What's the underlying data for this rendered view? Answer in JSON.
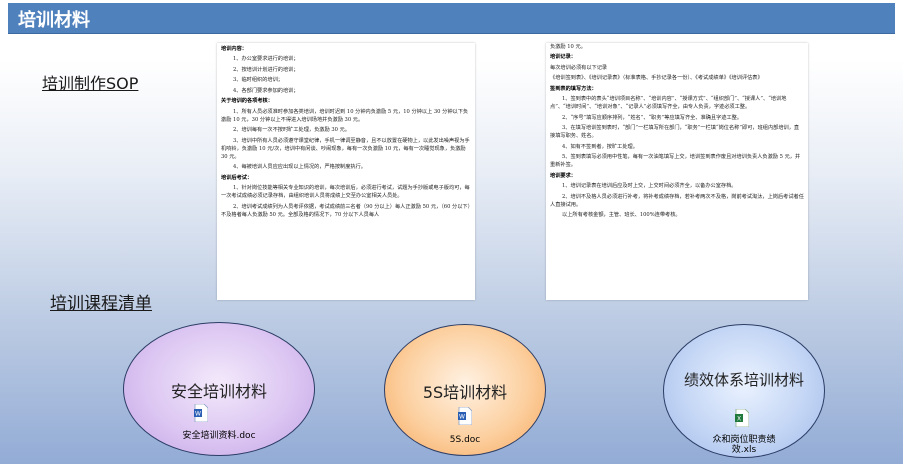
{
  "header": {
    "title": "培训材料"
  },
  "links": {
    "sop": "培训制作SOP",
    "course_list": "培训课程清单"
  },
  "doc_left": {
    "lines": [
      {
        "t": "培训内容：",
        "h": true
      },
      {
        "t": "1、办公室要求进行的培训；",
        "in": true
      },
      {
        "t": "2、按培训计划进行的培训；",
        "in": true
      },
      {
        "t": "3、临时组织的培训；",
        "in": true
      },
      {
        "t": "4、各部门要求参加的培训；",
        "in": true
      },
      {
        "t": "关于培训的各项考核：",
        "h": true
      },
      {
        "t": "1、所有人员必须准时参加各类培训，培训时迟到 10 分钟内负激励 5 元，10 分钟以上 30 分钟以下负激励 10 元，30 分钟以上不得进入培训场地并负激励 30 元。",
        "in": true
      },
      {
        "t": "2、培训每有一次不按时旷工处理，负激励 30 元。",
        "in": true
      },
      {
        "t": "3、培训中所有人员必须遵守课堂纪律，手机一律调至静音，且不以放置在硬物上，以此发出噪声视为手机响铃，负激励 10 元/次，培训中有闲谈、吵闹现象，每有一次负激励 10 元，每有一次睡觉现象，负激励 30 元。",
        "in": true
      },
      {
        "t": "4、每被培训人员应应出现以上情况的，严格按制度执行。",
        "in": true
      },
      {
        "t": "培训后考试：",
        "h": true
      },
      {
        "t": "1、针对岗位技能等相关专业知识的培训，每次培训后，必须进行考试，试题为手抄版或电子版均可，每一次考试成绩必须记录存档，由组织培训人员将成绩上交至办公室相关人员处。",
        "in": true
      },
      {
        "t": "2、培训考试成绩列为人员考评依据，考试成绩前三名者（90 分以上）每人正激励 50 元，（60 分以下）不及格者每人负激励 50 元。全部及格的情况下，70 分以下人员每人",
        "in": true
      }
    ]
  },
  "doc_right": {
    "lines": [
      {
        "t": "负激励 10 元。"
      },
      {
        "t": "培训记录：",
        "h": true
      },
      {
        "t": "每次培训必须有以下记录"
      },
      {
        "t": "《培训签到表》、《培训记录表》（标准表格、手抄记录各一份）、《考试成绩单》《培训评估表》"
      },
      {
        "t": "签到表的填写方法：",
        "h": true
      },
      {
        "t": "1、签到表中的表头“培训项目名称”、“培训内容”、“授课方式”、“组织部门”、“授课人”、“培训地点”、“培训时间”、“培训对象”、“记录人”必须填写齐全，由专人负责，字迹必须工整。",
        "in": true
      },
      {
        "t": "2、“序号”填写应顺序排列，“姓名”、“职务”等应填写齐全、准确且字迹工整。",
        "in": true
      },
      {
        "t": "3、在填写培训签到表时，“部门”一栏填写所在部门，“职务”一栏填“岗位名称”即可，班组内部培训，直接填写职务、姓名。",
        "in": true
      },
      {
        "t": "4、如有不签到者，按旷工处理。",
        "in": true
      },
      {
        "t": "5、签到表填写必须用中性笔，每有一次油笔填写上交，培训签到表作废且对培训负责人负激励 5 元，并重新补签。",
        "in": true
      },
      {
        "t": "培训要求：",
        "h": true
      },
      {
        "t": "1、培训记录表在培训后应及时上交，上交时间必须齐全，以备办公室存档。",
        "in": true
      },
      {
        "t": "2、培训不及格人员必须进行补考，将补考成绩存档，若补考两次不及格，岗前考试淘汰，上岗后考试者任人直接试用。",
        "in": true
      },
      {
        "t": "以上所有考核金额，主管、班长、100%连带考核。",
        "in": true
      }
    ]
  },
  "materials": [
    {
      "label": "安全培训材料",
      "file": "安全培训资料.doc",
      "icon": "word-doc-icon",
      "color": "#c7a8e8"
    },
    {
      "label": "5S培训材料",
      "file": "5S.doc",
      "icon": "word-doc-icon",
      "color": "#f7a85a"
    },
    {
      "label": "绩效体系培训材料",
      "file": "众和岗位职责绩效.xls",
      "icon": "excel-xls-icon",
      "color": "#9bb7ea"
    }
  ]
}
